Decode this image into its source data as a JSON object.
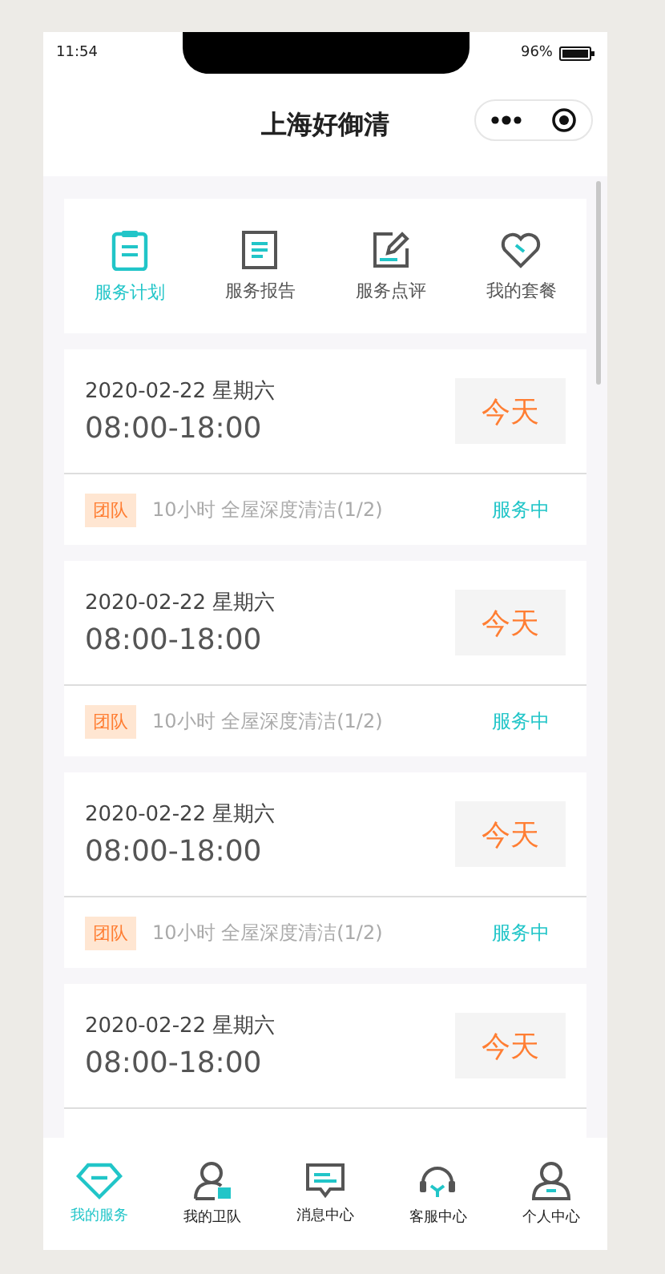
{
  "status_bar": {
    "time": "11:54",
    "battery": "96%"
  },
  "nav": {
    "title": "上海好御清"
  },
  "menu": [
    {
      "label": "服务计划",
      "selected": true
    },
    {
      "label": "服务报告",
      "selected": false
    },
    {
      "label": "服务点评",
      "selected": false
    },
    {
      "label": "我的套餐",
      "selected": false
    }
  ],
  "orders": [
    {
      "date": "2020-02-22 星期六",
      "time": "08:00-18:00",
      "day": "今天",
      "tag": "团队",
      "description": "10小时 全屋深度清洁(1/2)",
      "status": "服务中"
    },
    {
      "date": "2020-02-22 星期六",
      "time": "08:00-18:00",
      "day": "今天",
      "tag": "团队",
      "description": "10小时 全屋深度清洁(1/2)",
      "status": "服务中"
    },
    {
      "date": "2020-02-22 星期六",
      "time": "08:00-18:00",
      "day": "今天",
      "tag": "团队",
      "description": "10小时 全屋深度清洁(1/2)",
      "status": "服务中"
    },
    {
      "date": "2020-02-22 星期六",
      "time": "08:00-18:00",
      "day": "今天"
    }
  ],
  "tab_bar": [
    {
      "label": "我的服务",
      "selected": true
    },
    {
      "label": "我的卫队",
      "selected": false
    },
    {
      "label": "消息中心",
      "selected": false
    },
    {
      "label": "客服中心",
      "selected": false
    },
    {
      "label": "个人中心",
      "selected": false
    }
  ]
}
